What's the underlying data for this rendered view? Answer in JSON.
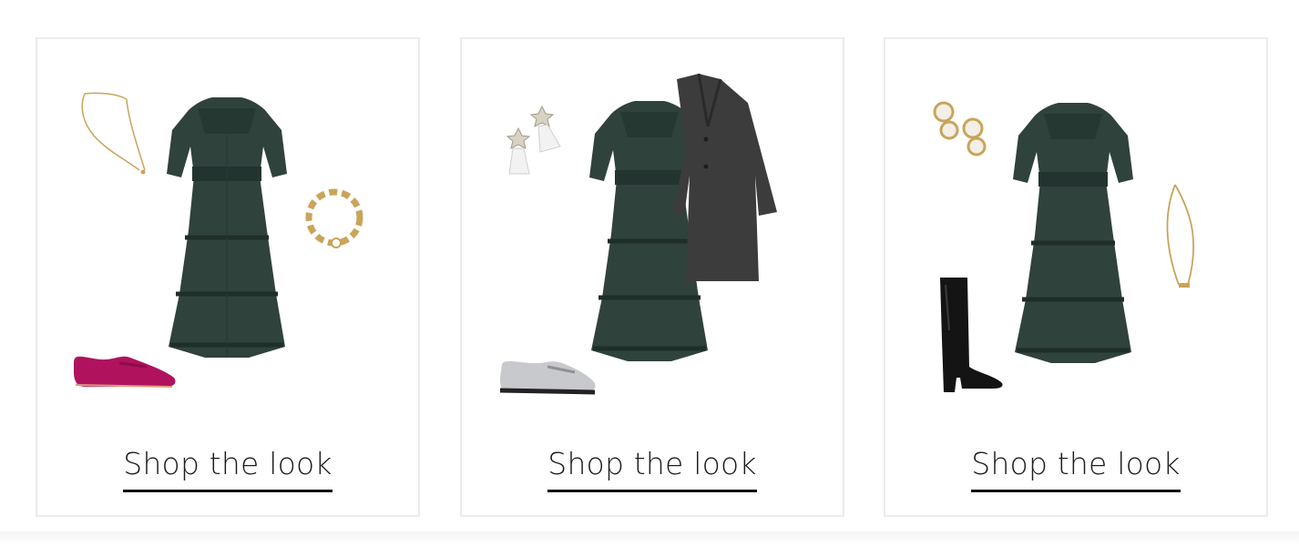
{
  "looks": [
    {
      "cta_label": "Shop the look",
      "items": [
        "necklace-icon",
        "green-tiered-dress-icon",
        "gold-bracelet-icon",
        "pink-loafer-icon"
      ]
    },
    {
      "cta_label": "Shop the look",
      "items": [
        "star-earrings-icon",
        "green-tiered-dress-icon",
        "grey-coat-icon",
        "silver-loafer-icon"
      ]
    },
    {
      "cta_label": "Shop the look",
      "items": [
        "pearl-earrings-icon",
        "green-tiered-dress-icon",
        "pendant-necklace-icon",
        "black-boot-icon"
      ]
    }
  ],
  "colors": {
    "dress": "#2f423b",
    "dress_shadow": "#1f2e29",
    "gold": "#c9a45a",
    "pink": "#b0125e",
    "coat": "#3c3c3c",
    "silver": "#c7c9cc",
    "boot": "#141414",
    "card_border": "#ececec",
    "cta_text": "#1c1c1c"
  }
}
